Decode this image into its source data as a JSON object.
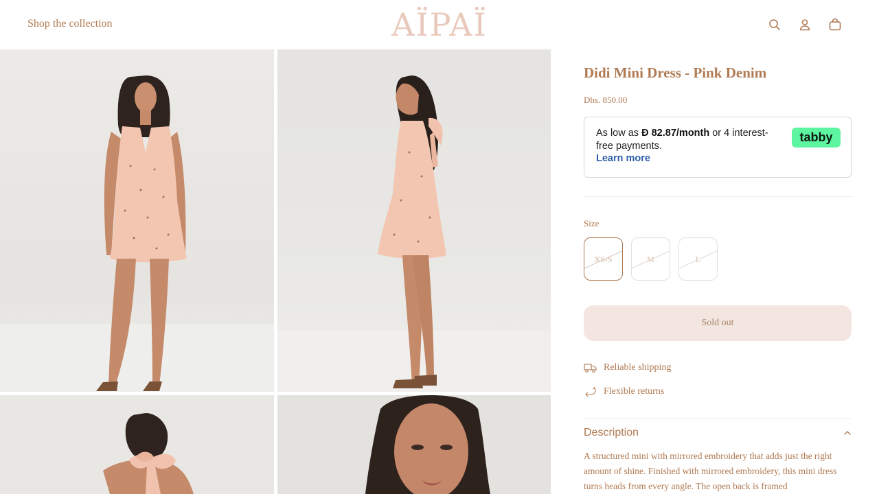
{
  "header": {
    "shop_link": "Shop the collection",
    "logo": "AÏPAÏ",
    "icons": [
      "search-icon",
      "account-icon",
      "cart-icon"
    ]
  },
  "product": {
    "title": "Didi Mini Dress - Pink Denim",
    "price": "Dhs. 850.00",
    "tabby": {
      "prefix": "As low as ",
      "currency_symbol": "Ð",
      "amount": " 82.87/month",
      "suffix": " or 4 interest-free payments.",
      "learn_more": "Learn more",
      "badge": "tabby"
    },
    "size_label": "Size",
    "sizes": [
      {
        "label": "XS-S",
        "selected": true,
        "available": false
      },
      {
        "label": "M",
        "selected": false,
        "available": false
      },
      {
        "label": "L",
        "selected": false,
        "available": false
      }
    ],
    "sold_out": "Sold out",
    "features": [
      {
        "icon": "truck-icon",
        "label": "Reliable shipping"
      },
      {
        "icon": "return-arrow-icon",
        "label": "Flexible returns"
      }
    ],
    "description": {
      "title": "Description",
      "text": "A structured mini with mirrored embroidery that adds just the right amount of shine. Finished with mirrored embroidery, this mini dress turns heads from every angle. The open back is framed"
    }
  },
  "colors": {
    "accent": "#b07a52",
    "logo": "#e8c9bb",
    "sold_out_bg": "#f3e5df",
    "tabby_badge": "#5ef5a1",
    "learn_more": "#2f5fa8"
  }
}
